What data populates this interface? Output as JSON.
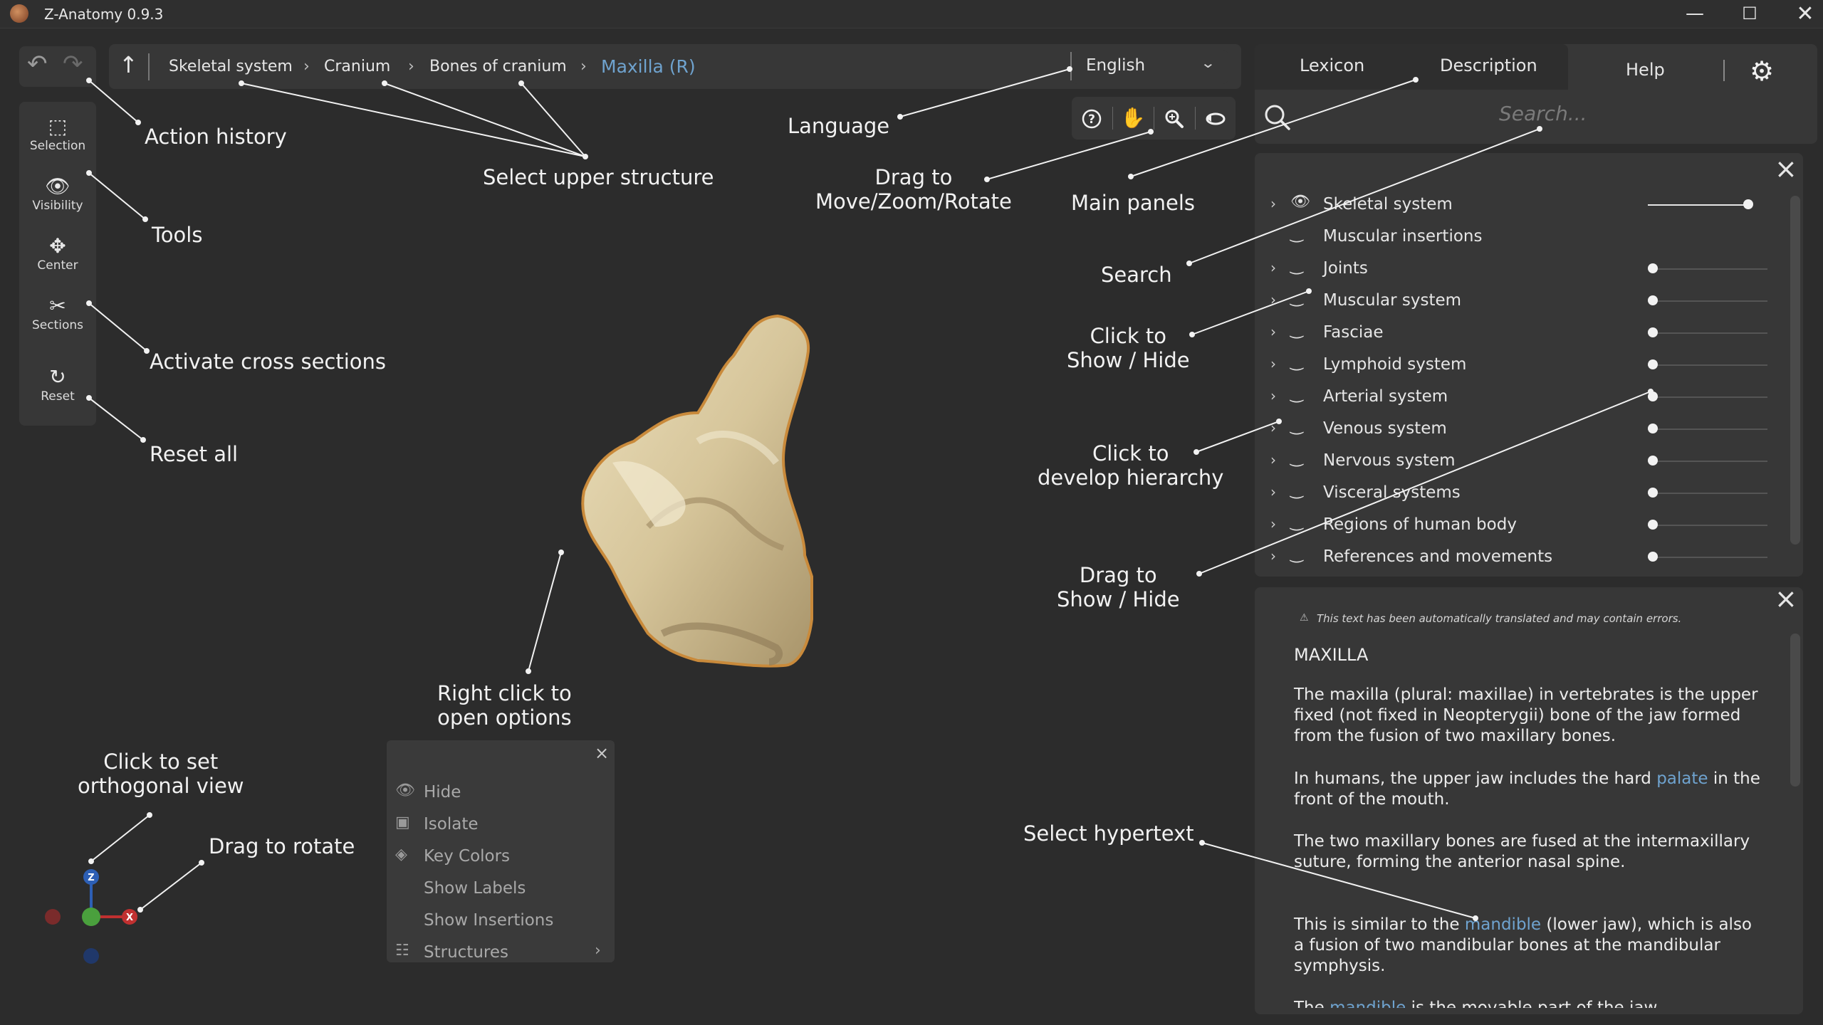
{
  "window": {
    "title": "Z-Anatomy 0.9.3",
    "controls": [
      "minimize",
      "maximize",
      "close"
    ]
  },
  "breadcrumb": {
    "items": [
      "Skeletal system",
      "Cranium",
      "Bones of cranium",
      "Maxilla (R)"
    ],
    "separator": ">",
    "current_color": "#6fa3cf"
  },
  "language": {
    "selected": "English"
  },
  "toolbar": {
    "tools": [
      {
        "label": "Selection",
        "icon": "selection-icon"
      },
      {
        "label": "Visibility",
        "icon": "eye-icon"
      },
      {
        "label": "Center",
        "icon": "center-icon"
      },
      {
        "label": "Sections",
        "icon": "scissors-icon"
      },
      {
        "label": "Reset",
        "icon": "reset-icon"
      }
    ]
  },
  "view_tools": [
    "help-icon",
    "hand-icon",
    "zoom-icon",
    "rotate-icon"
  ],
  "panels": {
    "tabs": [
      "Lexicon",
      "Description",
      "Help"
    ],
    "search_placeholder": "Search..."
  },
  "layers": [
    {
      "label": "Skeletal system",
      "visible": true,
      "level": 0.85
    },
    {
      "label": "Muscular insertions",
      "visible": false,
      "level": null
    },
    {
      "label": "Joints",
      "visible": false,
      "level": 0
    },
    {
      "label": "Muscular system",
      "visible": false,
      "level": 0
    },
    {
      "label": "Fasciae",
      "visible": false,
      "level": 0
    },
    {
      "label": "Lymphoid system",
      "visible": false,
      "level": 0
    },
    {
      "label": "Arterial system",
      "visible": false,
      "level": 0
    },
    {
      "label": "Venous system",
      "visible": false,
      "level": 0
    },
    {
      "label": "Nervous system",
      "visible": false,
      "level": 0
    },
    {
      "label": "Visceral systems",
      "visible": false,
      "level": 0
    },
    {
      "label": "Regions of human body",
      "visible": false,
      "level": 0
    },
    {
      "label": "References and movements",
      "visible": false,
      "level": 0
    }
  ],
  "description": {
    "note": "This text has been automatically translated and may contain errors.",
    "title": "MAXILLA",
    "p1": "The maxilla (plural: maxillae) in vertebrates is the upper fixed (not fixed in Neopterygii) bone of the jaw formed from the fusion of two maxillary bones.",
    "p2_a": "In humans, the upper jaw includes the hard ",
    "p2_link": "palate",
    "p2_b": " in the front of the mouth.",
    "p3": "The two maxillary bones are fused at the intermaxillary suture, forming the anterior nasal spine.",
    "p4_a": "This is similar to the ",
    "p4_link": "mandible",
    "p4_b": " (lower jaw), which is also a fusion of two mandibular bones at the mandibular symphysis.",
    "p5_a": "The ",
    "p5_link": "mandible",
    "p5_b": " is the movable part of the jaw."
  },
  "context_menu": {
    "items": [
      {
        "label": "Hide",
        "icon": "hide-icon"
      },
      {
        "label": "Isolate",
        "icon": "isolate-icon"
      },
      {
        "label": "Key Colors",
        "icon": "paint-bucket-icon"
      },
      {
        "label": "Show Labels",
        "icon": ""
      },
      {
        "label": "Show Insertions",
        "icon": ""
      },
      {
        "label": "Structures",
        "icon": "hierarchy-icon"
      }
    ]
  },
  "gizmo": {
    "z_label": "Z",
    "x_label": "X"
  },
  "annotations": {
    "action_history": "Action history",
    "tools": "Tools",
    "activate_sections": "Activate cross sections",
    "reset_all": "Reset all",
    "select_upper": "Select upper structure",
    "language": "Language",
    "drag_move_1": "Drag to",
    "drag_move_2": "Move/Zoom/Rotate",
    "main_panels": "Main panels",
    "search": "Search",
    "click_show_1": "Click to",
    "click_show_2": "Show / Hide",
    "click_dev_1": "Click to",
    "click_dev_2": "develop hierarchy",
    "drag_show_1": "Drag to",
    "drag_show_2": "Show / Hide",
    "right_click_1": "Right click to",
    "right_click_2": "open options",
    "ortho_1": "Click to set",
    "ortho_2": "orthogonal view",
    "drag_rotate": "Drag to rotate",
    "hypertext": "Select hypertext"
  }
}
